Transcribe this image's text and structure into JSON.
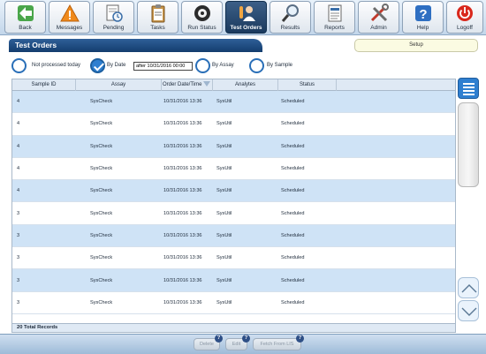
{
  "toolbar": {
    "buttons": [
      {
        "label": "Back",
        "icon": "back-arrow-icon"
      },
      {
        "label": "Messages",
        "icon": "warning-icon"
      },
      {
        "label": "Pending",
        "icon": "pending-icon"
      },
      {
        "label": "Tasks",
        "icon": "clipboard-icon"
      },
      {
        "label": "Run Status",
        "icon": "run-status-icon"
      },
      {
        "label": "Test Orders",
        "icon": "test-orders-icon"
      },
      {
        "label": "Results",
        "icon": "magnifier-icon"
      },
      {
        "label": "Reports",
        "icon": "reports-icon"
      },
      {
        "label": "Admin",
        "icon": "tools-icon"
      },
      {
        "label": "Help",
        "icon": "help-icon"
      },
      {
        "label": "Logoff",
        "icon": "power-icon"
      }
    ],
    "active": "Test Orders"
  },
  "page": {
    "title": "Test Orders",
    "setup_label": "Setup"
  },
  "filters": {
    "not_processed_label": "Not processed today",
    "by_date_label": "By Date",
    "date_value": "after 10/31/2016 00:00",
    "by_assay_label": "By Assay",
    "by_sample_label": "By Sample",
    "selected": "By Date"
  },
  "table": {
    "columns": [
      "Sample ID",
      "Assay",
      "Order Date/Time",
      "Analytes",
      "Status"
    ],
    "rows": [
      {
        "sample_id": "4",
        "assay": "SysCheck",
        "datetime": "10/31/2016 13:36",
        "analytes": "SysUtil",
        "status": "Scheduled"
      },
      {
        "sample_id": "4",
        "assay": "SysCheck",
        "datetime": "10/31/2016 13:36",
        "analytes": "SysUtil",
        "status": "Scheduled"
      },
      {
        "sample_id": "4",
        "assay": "SysCheck",
        "datetime": "10/31/2016 13:36",
        "analytes": "SysUtil",
        "status": "Scheduled"
      },
      {
        "sample_id": "4",
        "assay": "SysCheck",
        "datetime": "10/31/2016 13:36",
        "analytes": "SysUtil",
        "status": "Scheduled"
      },
      {
        "sample_id": "4",
        "assay": "SysCheck",
        "datetime": "10/31/2016 13:36",
        "analytes": "SysUtil",
        "status": "Scheduled"
      },
      {
        "sample_id": "3",
        "assay": "SysCheck",
        "datetime": "10/31/2016 13:36",
        "analytes": "SysUtil",
        "status": "Scheduled"
      },
      {
        "sample_id": "3",
        "assay": "SysCheck",
        "datetime": "10/31/2016 13:36",
        "analytes": "SysUtil",
        "status": "Scheduled"
      },
      {
        "sample_id": "3",
        "assay": "SysCheck",
        "datetime": "10/31/2016 13:36",
        "analytes": "SysUtil",
        "status": "Scheduled"
      },
      {
        "sample_id": "3",
        "assay": "SysCheck",
        "datetime": "10/31/2016 13:36",
        "analytes": "SysUtil",
        "status": "Scheduled"
      },
      {
        "sample_id": "3",
        "assay": "SysCheck",
        "datetime": "10/31/2016 13:36",
        "analytes": "SysUtil",
        "status": "Scheduled"
      }
    ],
    "total_label": "20 Total Records"
  },
  "actions": {
    "delete_label": "Delete",
    "edit_label": "Edit",
    "fetch_label": "Fetch From LIS",
    "badge": "?"
  },
  "colors": {
    "title_bar": "#1f4d80",
    "row_alt": "#cfe3f6",
    "accent": "#2f7fd0"
  }
}
